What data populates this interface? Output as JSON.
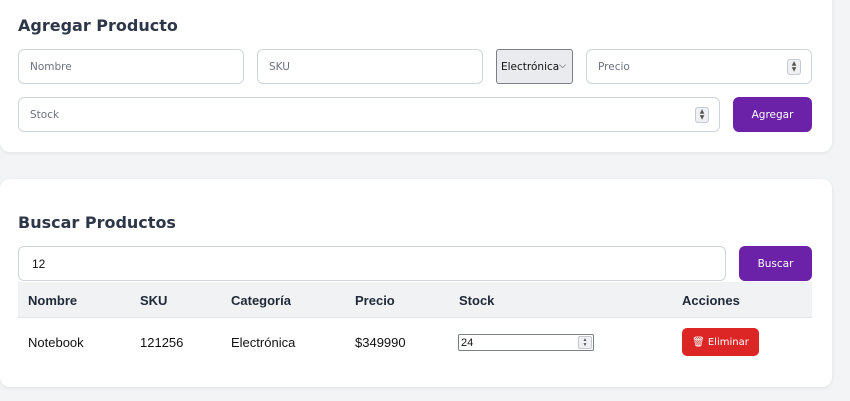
{
  "add_form": {
    "title": "Agregar Producto",
    "nombre_placeholder": "Nombre",
    "sku_placeholder": "SKU",
    "category_value": "Electrónica",
    "precio_placeholder": "Precio",
    "stock_placeholder": "Stock",
    "add_label": "Agregar"
  },
  "search": {
    "title": "Buscar Productos",
    "query": "12",
    "button_label": "Buscar"
  },
  "table": {
    "headers": [
      "Nombre",
      "SKU",
      "Categoría",
      "Precio",
      "Stock",
      "Acciones"
    ],
    "rows": [
      {
        "nombre": "Notebook",
        "sku": "121256",
        "categoria": "Electrónica",
        "precio": "$349990",
        "stock": "24",
        "action_label": "Eliminar"
      }
    ]
  },
  "colors": {
    "primary": "#6b21a8",
    "danger": "#dc2626"
  },
  "icons": {
    "delete": "trash-icon",
    "select": "chevron-down-icon",
    "number": "spinner-icon"
  }
}
